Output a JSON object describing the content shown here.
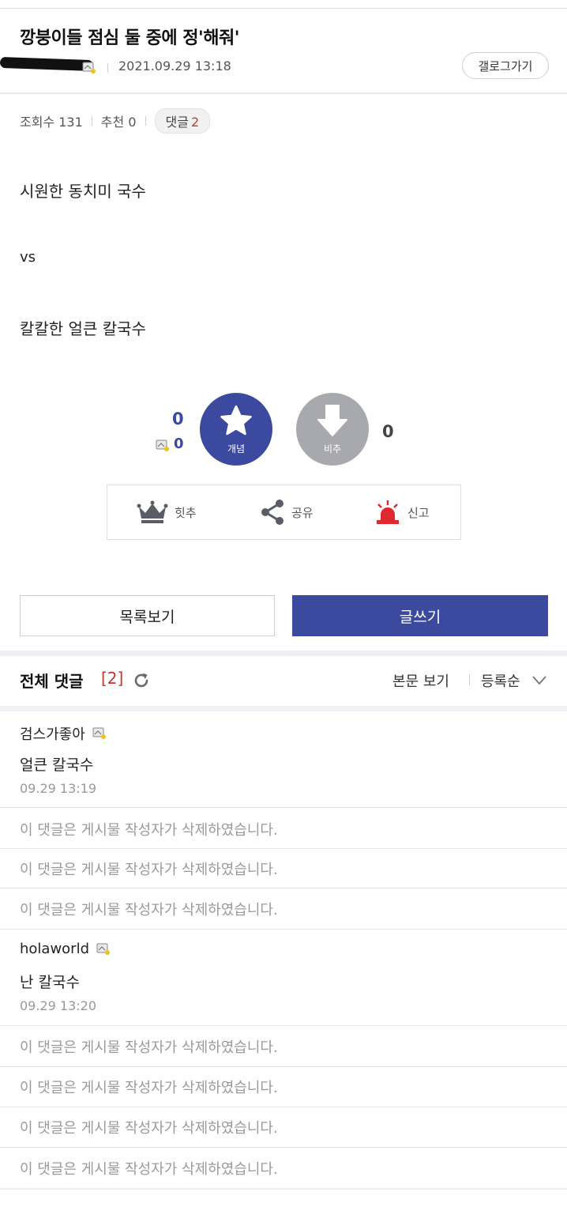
{
  "post": {
    "title": "깡붕이들 점심 둘 중에 정'해줘'",
    "date": "2021.09.29 13:18",
    "gallog_button": "갤로그가기",
    "views_label": "조회수 131",
    "recommend_label": "추천 0",
    "comments_label": "댓글",
    "comments_count": "2",
    "body": [
      "시원한 동치미 국수",
      "vs",
      "칼칼한 얼큰 칼국수"
    ]
  },
  "votes": {
    "up_count": "0",
    "fix_count": "0",
    "up_label": "개념",
    "down_label": "비추",
    "down_count": "0"
  },
  "actions": {
    "hit_label": "힛추",
    "share_label": "공유",
    "report_label": "신고"
  },
  "buttons": {
    "list": "목록보기",
    "write": "글쓰기"
  },
  "comments_section": {
    "title": "전체 댓글",
    "count": "[2]",
    "view_body": "본문 보기",
    "sort": "등록순"
  },
  "comments": [
    {
      "author": "검스가좋아",
      "text": "얼큰 칼국수",
      "date": "09.29 13:19"
    },
    {
      "author": "holaworld",
      "text": "난 칼국수",
      "date": "09.29 13:20"
    }
  ],
  "deleted_text": "이 댓글은 게시물 작성자가 삭제하였습니다.",
  "colors": {
    "accent": "#3b4a9e",
    "down_button": "#a8a9ae",
    "comment_count": "#c0392b",
    "report_red": "#e0282f"
  },
  "icons": {
    "author_badge": "fixed-nick-icon",
    "up": "star-icon",
    "down": "arrow-down-icon",
    "hit": "crown-icon",
    "share": "share-icon",
    "report": "siren-icon",
    "refresh": "refresh-icon",
    "sort": "chevron-down-icon"
  }
}
